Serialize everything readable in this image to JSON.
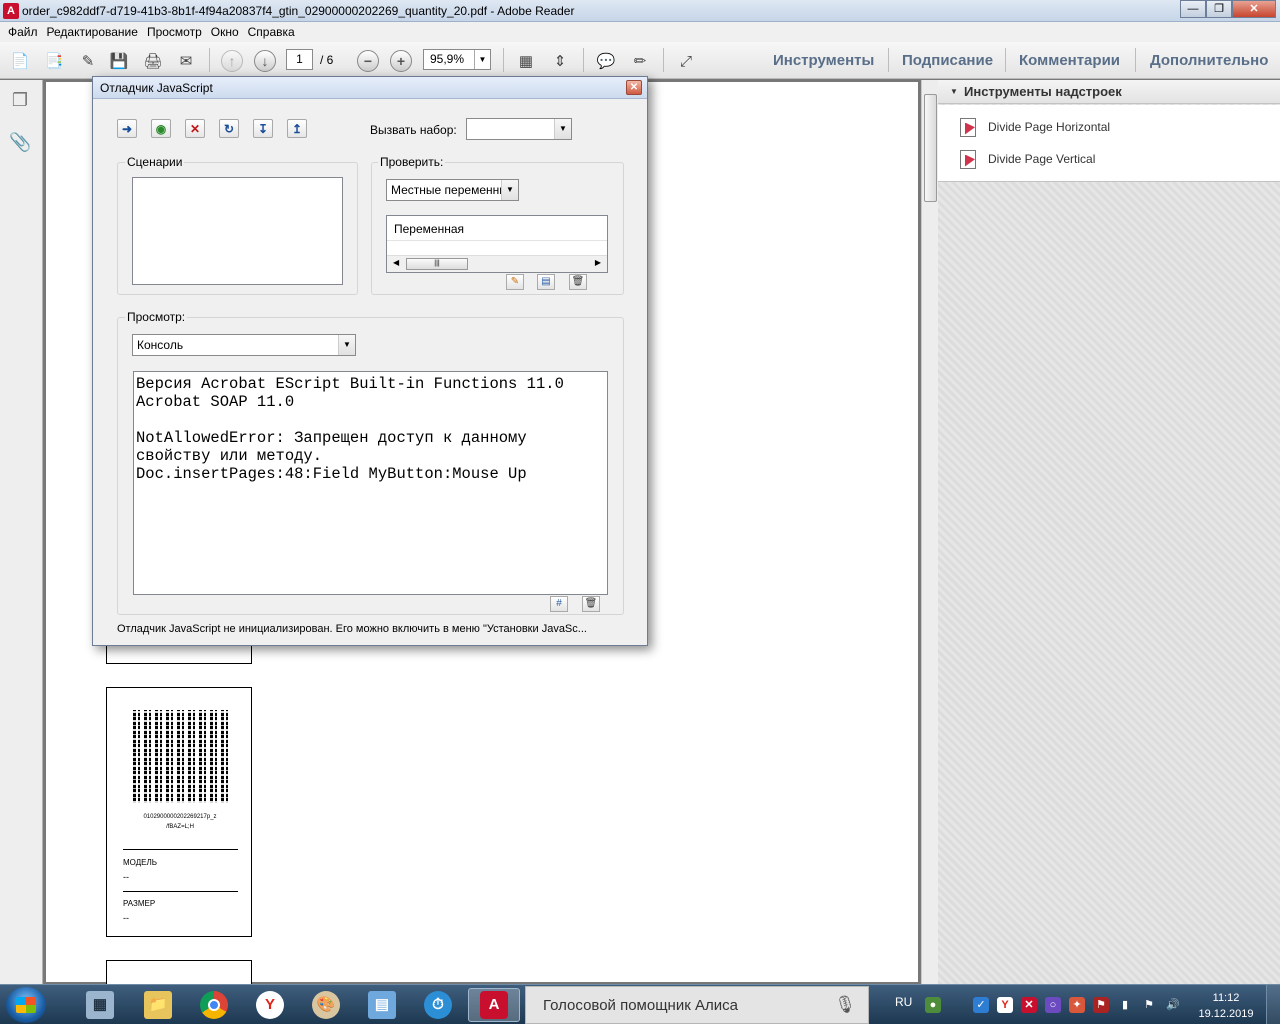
{
  "window": {
    "title": "order_c982ddf7-d719-41b3-8b1f-4f94a20837f4_gtin_02900000202269_quantity_20.pdf - Adobe Reader"
  },
  "menu": [
    "Файл",
    "Редактирование",
    "Просмотр",
    "Окно",
    "Справка"
  ],
  "toolbar": {
    "page_current": "1",
    "page_total": "/ 6",
    "zoom": "95,9%",
    "links": [
      "Инструменты",
      "Подписание",
      "Комментарии",
      "Дополнительно"
    ]
  },
  "right_panel": {
    "header": "Инструменты надстроек",
    "items": [
      "Divide Page Horizontal",
      "Divide Page Vertical"
    ]
  },
  "dialog": {
    "title": "Отладчик JavaScript",
    "call_set_label": "Вызвать набор:",
    "call_set_value": "",
    "scripts_label": "Сценарии",
    "inspect_label": "Проверить:",
    "inspect_value": "Местные переменные",
    "variable_header": "Переменная",
    "view_label": "Просмотр:",
    "view_value": "Консоль",
    "console_lines": [
      "Версия Acrobat EScript Built-in Functions 11.0",
      "Acrobat SOAP 11.0",
      "",
      "NotAllowedError: Запрещен доступ к данному",
      "свойству или методу.",
      "Doc.insertPages:48:Field MyButton:Mouse Up"
    ],
    "status": "Отладчик JavaScript не инициализирован. Его можно включить в меню \"Установки JavaSc..."
  },
  "label_card": {
    "code": "0102900000202269217p_z\n/fBAZ=L;H",
    "model_label": "МОДЕЛЬ",
    "model_value": "--",
    "size_label": "РАЗМЕР",
    "size_value": "--"
  },
  "taskbar": {
    "alice_text": "Голосовой помощник Алиса",
    "lang": "RU",
    "time": "11:12",
    "date": "19.12.2019"
  },
  "colors": {
    "toolbar_link": "#596e88",
    "taskbar": "#1d3850"
  }
}
